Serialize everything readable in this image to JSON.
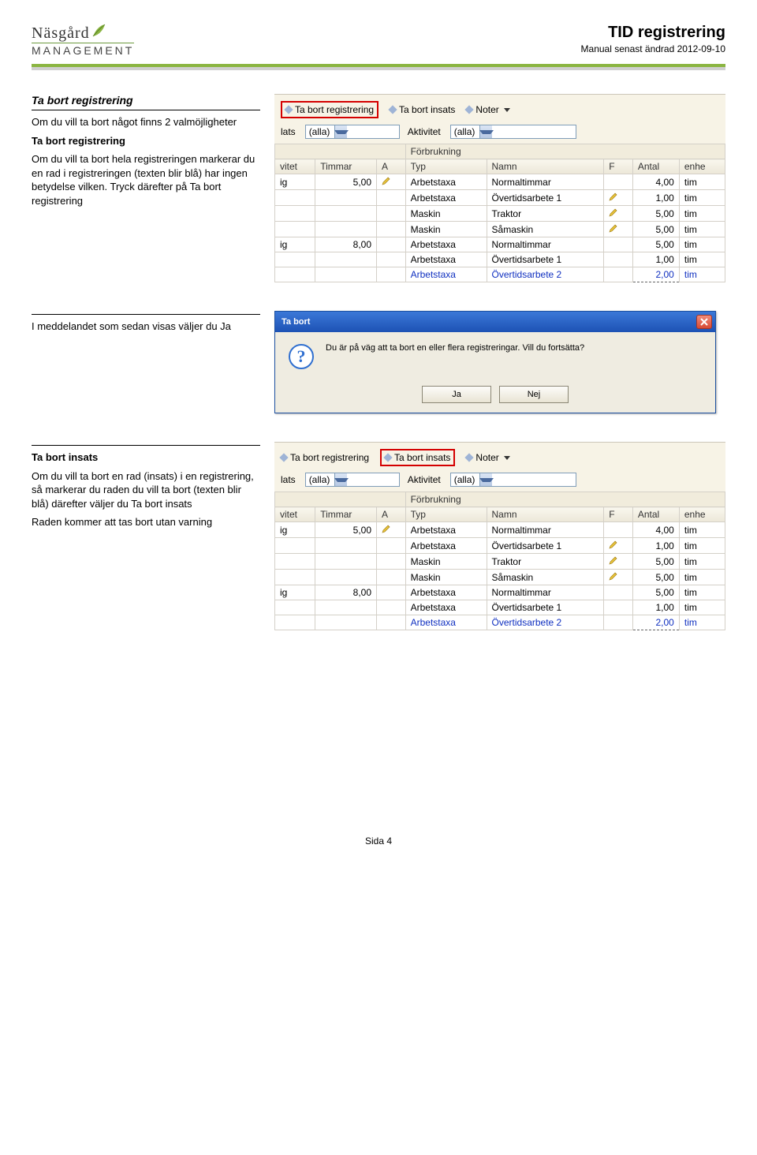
{
  "header": {
    "logo_top": "Näsgård",
    "logo_bottom": "MANAGEMENT",
    "title": "TID registrering",
    "subtitle": "Manual senast ändrad 2012-09-10"
  },
  "sections": {
    "s1": {
      "heading": "Ta bort registrering",
      "p1": "Om du vill ta bort något finns 2 valmöjligheter",
      "sub_bold": "Ta bort registrering",
      "p2": "Om du vill ta bort hela registreringen markerar du en rad i registreringen (texten blir blå) har ingen betydelse vilken. Tryck därefter på Ta bort registrering"
    },
    "s2": {
      "p1": "I meddelandet som sedan visas väljer du Ja"
    },
    "s3": {
      "heading": "Ta bort insats",
      "p1": "Om du vill ta bort en rad (insats) i en registrering, så markerar du raden du vill ta bort (texten blir blå) därefter väljer du Ta bort insats",
      "p2": "Raden kommer att tas bort utan varning"
    }
  },
  "app": {
    "toolbar": {
      "item1": "Ta bort registrering",
      "item2": "Ta bort insats",
      "item3": "Noter"
    },
    "filters": {
      "label1": "lats",
      "value1": "(alla)",
      "label2": "Aktivitet",
      "value2": "(alla)"
    },
    "grid": {
      "grouphdr": "Förbrukning",
      "cols": [
        "vitet",
        "Timmar",
        "A",
        "Typ",
        "Namn",
        "F",
        "Antal",
        "enhe"
      ],
      "rows": [
        {
          "c0": "ig",
          "c1": "5,00",
          "pencil": true,
          "c3": "Arbetstaxa",
          "c4": "Normaltimmar",
          "f": false,
          "c6": "4,00",
          "c7": "tim"
        },
        {
          "c0": "",
          "c1": "",
          "pencil": false,
          "c3": "Arbetstaxa",
          "c4": "Övertidsarbete 1",
          "f": true,
          "c6": "1,00",
          "c7": "tim"
        },
        {
          "c0": "",
          "c1": "",
          "pencil": false,
          "c3": "Maskin",
          "c4": "Traktor",
          "f": true,
          "c6": "5,00",
          "c7": "tim"
        },
        {
          "c0": "",
          "c1": "",
          "pencil": false,
          "c3": "Maskin",
          "c4": "Såmaskin",
          "f": true,
          "c6": "5,00",
          "c7": "tim"
        },
        {
          "c0": "ig",
          "c1": "8,00",
          "pencil": false,
          "c3": "Arbetstaxa",
          "c4": "Normaltimmar",
          "f": false,
          "c6": "5,00",
          "c7": "tim"
        },
        {
          "c0": "",
          "c1": "",
          "pencil": false,
          "c3": "Arbetstaxa",
          "c4": "Övertidsarbete 1",
          "f": false,
          "c6": "1,00",
          "c7": "tim"
        },
        {
          "c0": "",
          "c1": "",
          "pencil": false,
          "c3": "Arbetstaxa",
          "c4": "Övertidsarbete 2",
          "f": false,
          "c6": "2,00",
          "c7": "tim",
          "blue": true,
          "dotted": true
        }
      ]
    }
  },
  "dialog": {
    "title": "Ta bort",
    "message": "Du är på väg att ta bort en eller flera registreringar. Vill du fortsätta?",
    "yes": "Ja",
    "no": "Nej"
  },
  "footer": "Sida 4",
  "highlight_index": {
    "first": 0,
    "second": 1
  }
}
